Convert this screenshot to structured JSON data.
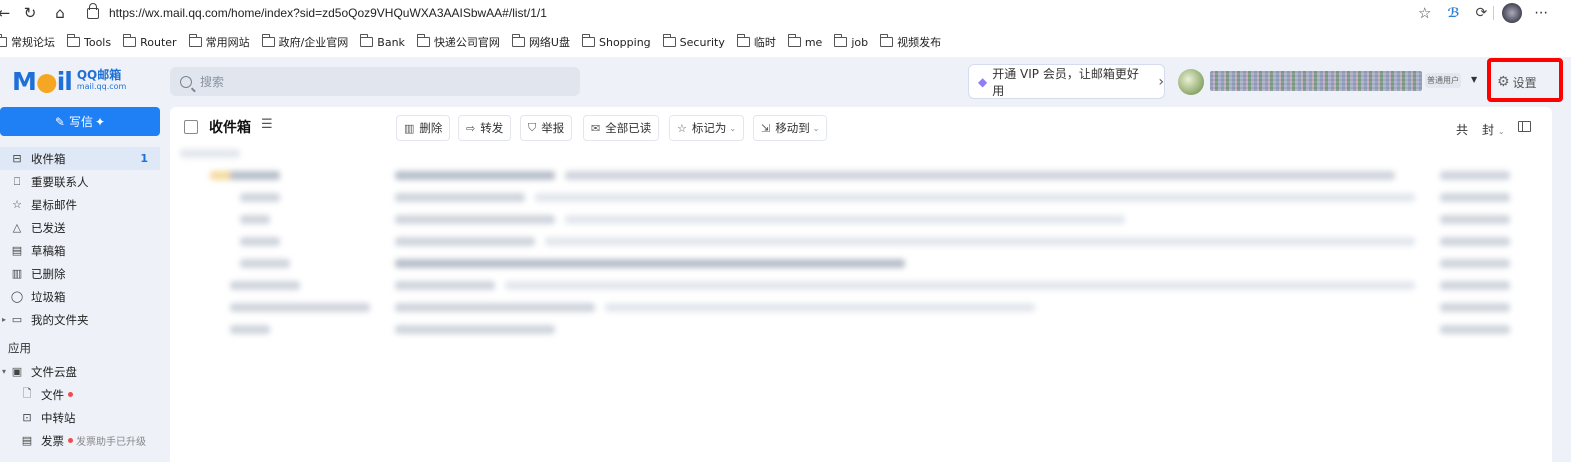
{
  "browser": {
    "url": "https://wx.mail.qq.com/home/index?sid=zd5oQoz9VHQuWXA3AAISbwAA#/list/1/1",
    "bookmarks": [
      "常规论坛",
      "Tools",
      "Router",
      "常用网站",
      "政府/企业官网",
      "Bank",
      "快递公司官网",
      "网络U盘",
      "Shopping",
      "Security",
      "临时",
      "me",
      "job",
      "视频发布"
    ]
  },
  "header": {
    "logo_main": "Mail",
    "logo_brand": "QQ邮箱",
    "logo_domain": "mail.qq.com",
    "search_placeholder": "搜索",
    "vip_banner": "开通 VIP 会员，让邮箱更好用",
    "user_type": "普通用户",
    "settings_label": "设置"
  },
  "sidebar": {
    "compose_label": "写信",
    "items": [
      {
        "label": "收件箱",
        "icon": "inbox-icon",
        "count": "1",
        "active": true
      },
      {
        "label": "重要联系人",
        "icon": "bookmark-icon"
      },
      {
        "label": "星标邮件",
        "icon": "star-icon"
      },
      {
        "label": "已发送",
        "icon": "sent-icon"
      },
      {
        "label": "草稿箱",
        "icon": "draft-icon"
      },
      {
        "label": "已删除",
        "icon": "trash-icon"
      },
      {
        "label": "垃圾箱",
        "icon": "spam-icon"
      },
      {
        "label": "我的文件夹",
        "icon": "folder-icon"
      }
    ],
    "apps_heading": "应用",
    "apps": [
      {
        "label": "文件云盘",
        "icon": "cloud-drive-icon"
      },
      {
        "label": "文件",
        "icon": "file-icon",
        "dot": true
      },
      {
        "label": "中转站",
        "icon": "transfer-icon"
      },
      {
        "label": "发票",
        "icon": "invoice-icon",
        "dot": true,
        "hint": "发票助手已升级"
      }
    ]
  },
  "main": {
    "folder_title": "收件箱",
    "toolbar": {
      "delete": "删除",
      "forward": "转发",
      "report": "举报",
      "mark_all_read": "全部已读",
      "mark_as": "标记为",
      "move_to": "移动到"
    },
    "total_prefix": "共",
    "total_suffix": "封"
  },
  "colors": {
    "accent": "#1f7ff4",
    "annotation": "#ff0000",
    "app_bg": "#eef2f8"
  }
}
